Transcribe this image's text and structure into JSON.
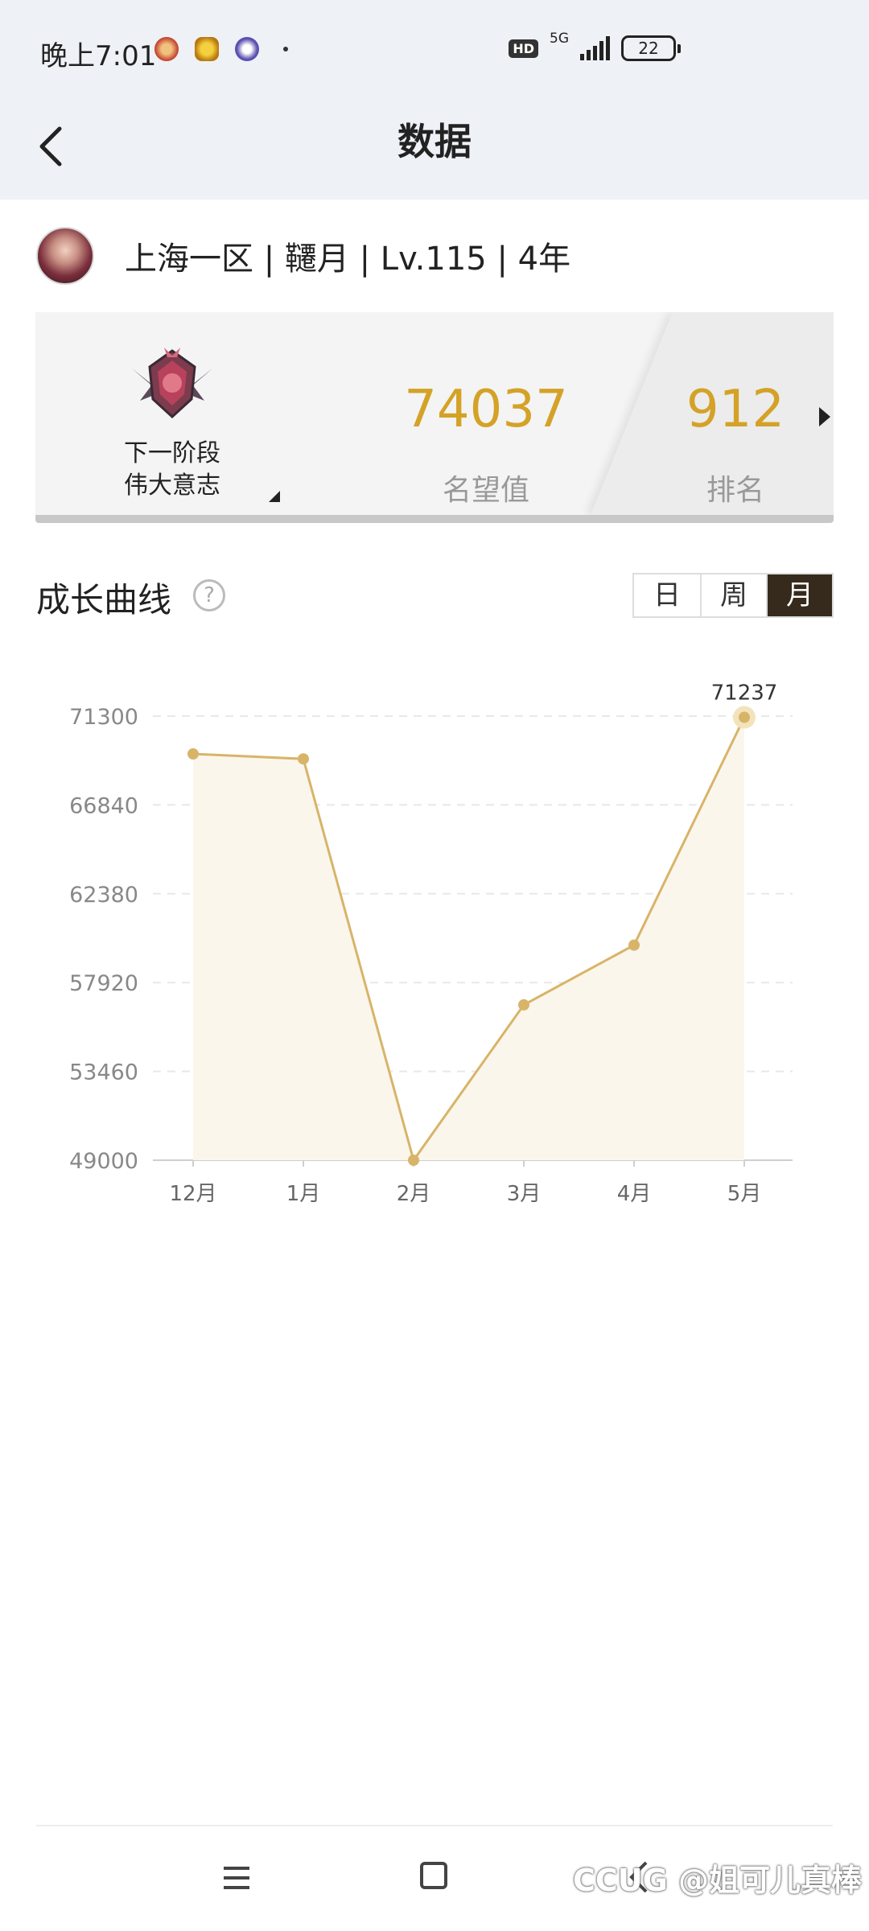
{
  "status_bar": {
    "time": "晚上7:01",
    "hd": "HD",
    "network": "5G",
    "battery": "22"
  },
  "header": {
    "title": "数据"
  },
  "profile": {
    "text": "上海一区 | 韆月 | Lv.115 | 4年"
  },
  "summary": {
    "stage_line1": "下一阶段",
    "stage_line2": "伟大意志",
    "reputation_value": "74037",
    "reputation_label": "名望值",
    "rank_value": "912",
    "rank_label": "排名"
  },
  "growth": {
    "title": "成长曲线",
    "help": "?",
    "tabs": [
      {
        "label": "日",
        "active": false
      },
      {
        "label": "周",
        "active": false
      },
      {
        "label": "月",
        "active": true
      }
    ]
  },
  "chart_data": {
    "type": "line",
    "categories": [
      "12月",
      "1月",
      "2月",
      "3月",
      "4月",
      "5月"
    ],
    "values": [
      69400,
      69150,
      49000,
      56800,
      59800,
      71237
    ],
    "yticks": [
      71300,
      66840,
      62380,
      57920,
      53460,
      49000
    ],
    "ylim": [
      49000,
      71300
    ],
    "highlight_label": "71237",
    "colors": {
      "line": "#d8b469",
      "area": "#fbf6ec",
      "grid": "#e8e8e8"
    }
  },
  "bottom_nav": {
    "watermark": "CCUG @姐可儿真棒"
  }
}
